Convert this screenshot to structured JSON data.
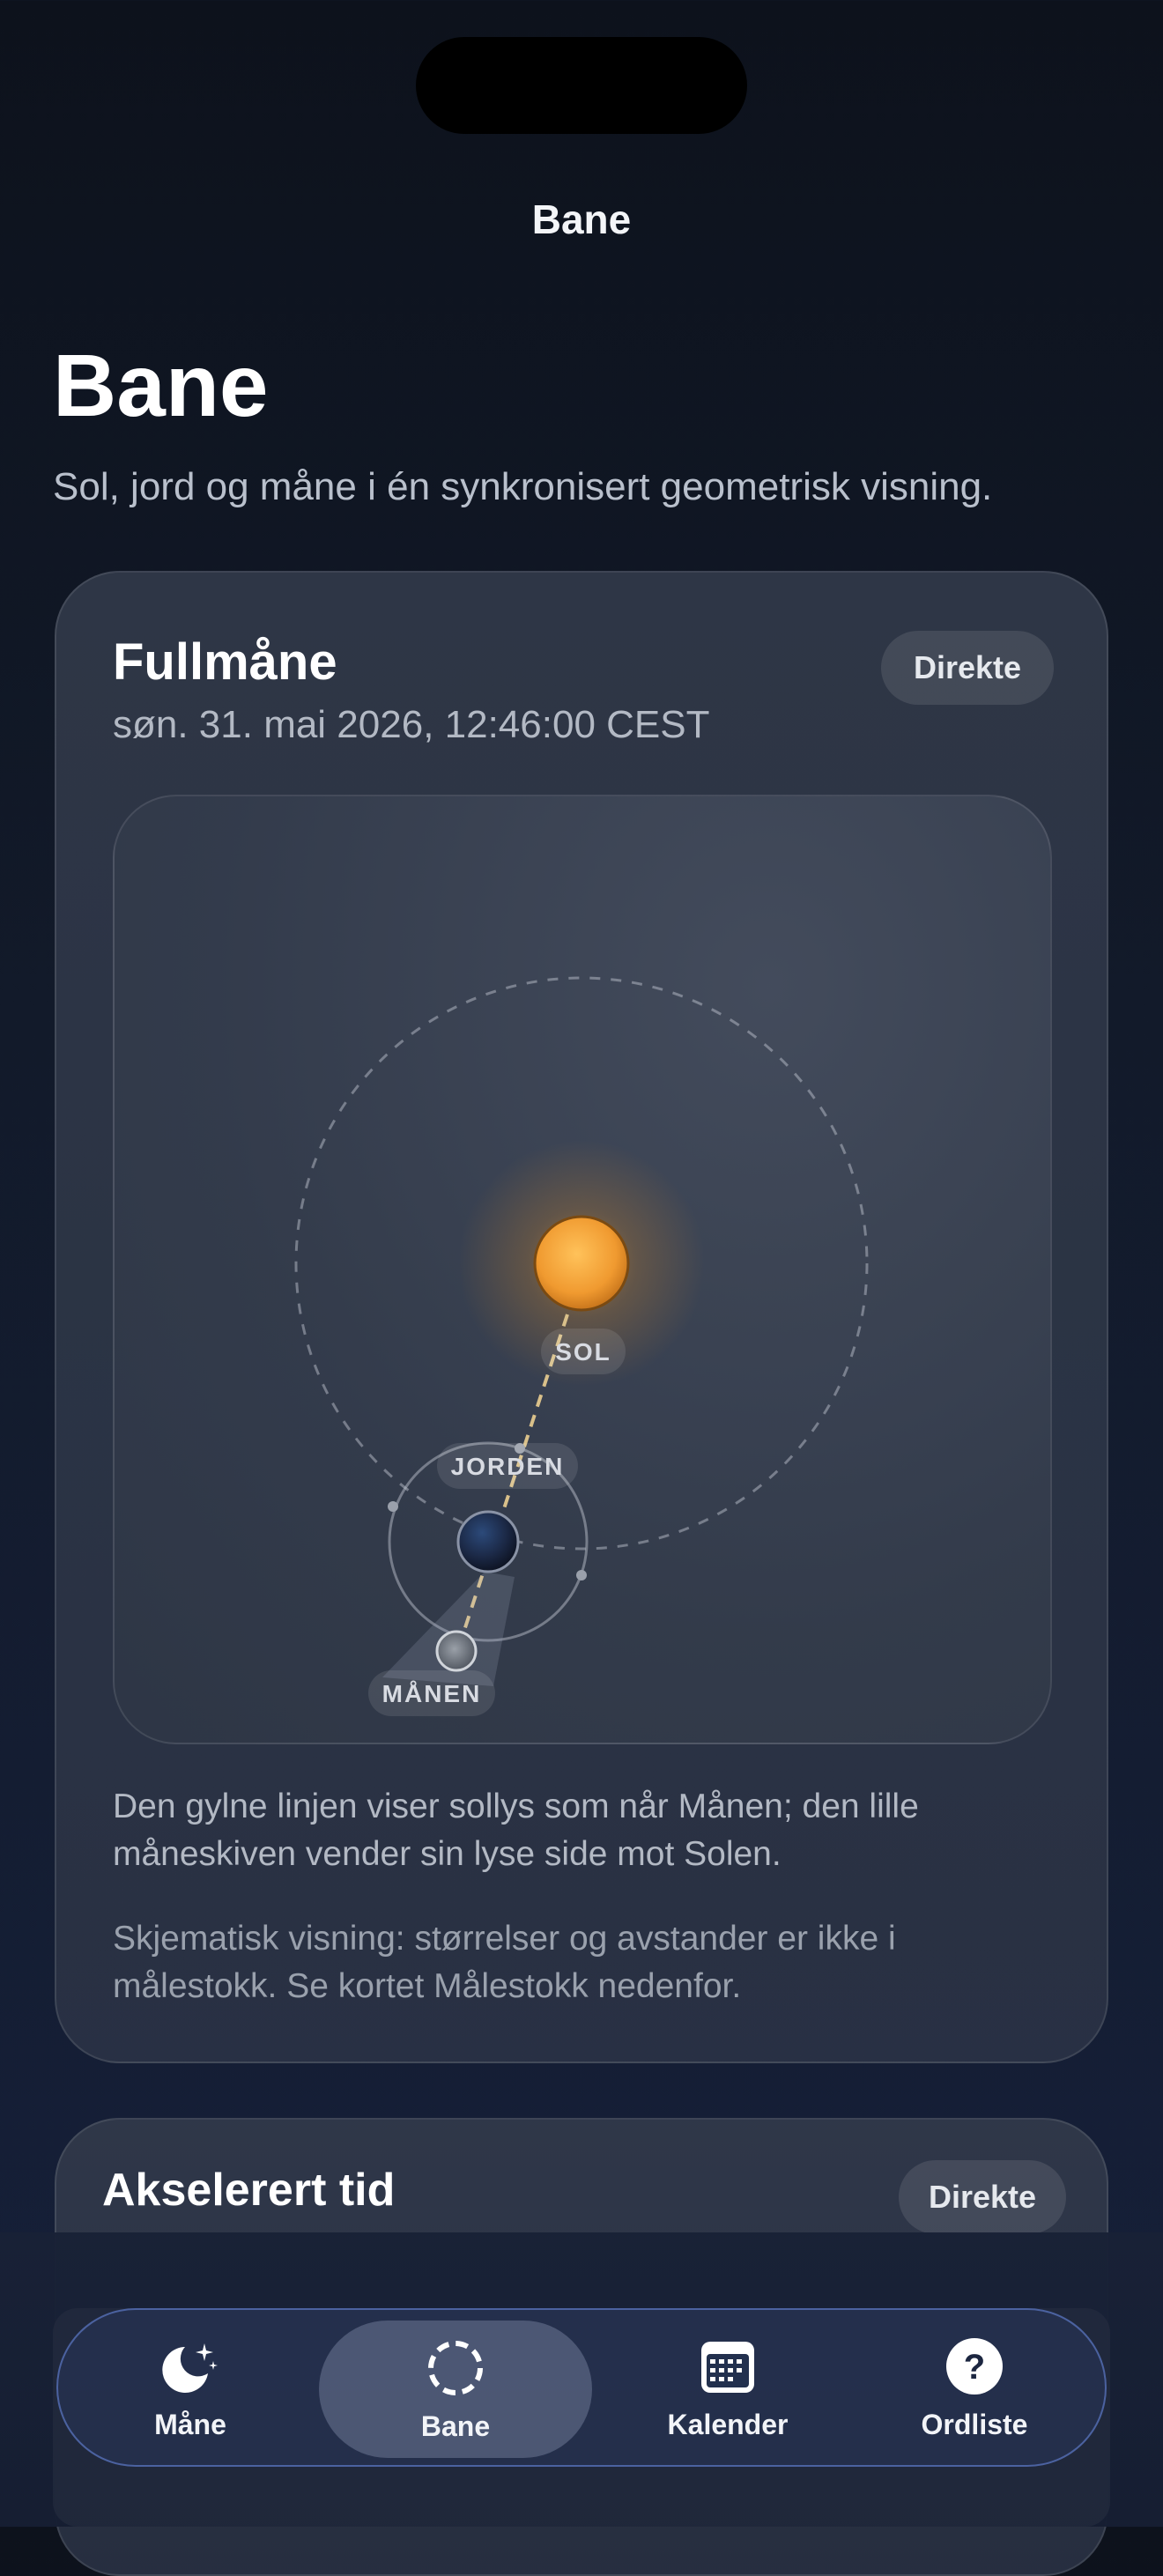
{
  "nav": {
    "title": "Bane"
  },
  "header": {
    "title": "Bane",
    "subtitle": "Sol, jord og måne i én synkronisert geometrisk visning."
  },
  "orbit_card": {
    "title": "Fullmåne",
    "date": "søn. 31. mai 2026, 12:46:00 CEST",
    "live_label": "Direkte",
    "labels": {
      "sun": "SOL",
      "earth": "JORDEN",
      "moon": "MÅNEN"
    },
    "description": "Den gylne linjen viser sollys som når Månen; den lille måneskiven vender sin lyse side mot Solen.",
    "note": "Skjematisk visning: størrelser og avstander er ikke i målestokk. Se kortet Målestokk nedenfor."
  },
  "accel_card": {
    "title": "Akselerert tid",
    "live_label": "Direkte"
  },
  "tabbar": {
    "tabs": [
      {
        "label": "Måne",
        "icon": "moon-stars-icon"
      },
      {
        "label": "Bane",
        "icon": "dashed-circle-icon",
        "active": true
      },
      {
        "label": "Kalender",
        "icon": "calendar-icon"
      },
      {
        "label": "Ordliste",
        "icon": "question-circle-icon"
      }
    ]
  },
  "colors": {
    "background": "#0d121c",
    "sun": "#f2a23a",
    "sunlight_line": "#d9c08a",
    "tab_border": "#6e8ce6"
  }
}
